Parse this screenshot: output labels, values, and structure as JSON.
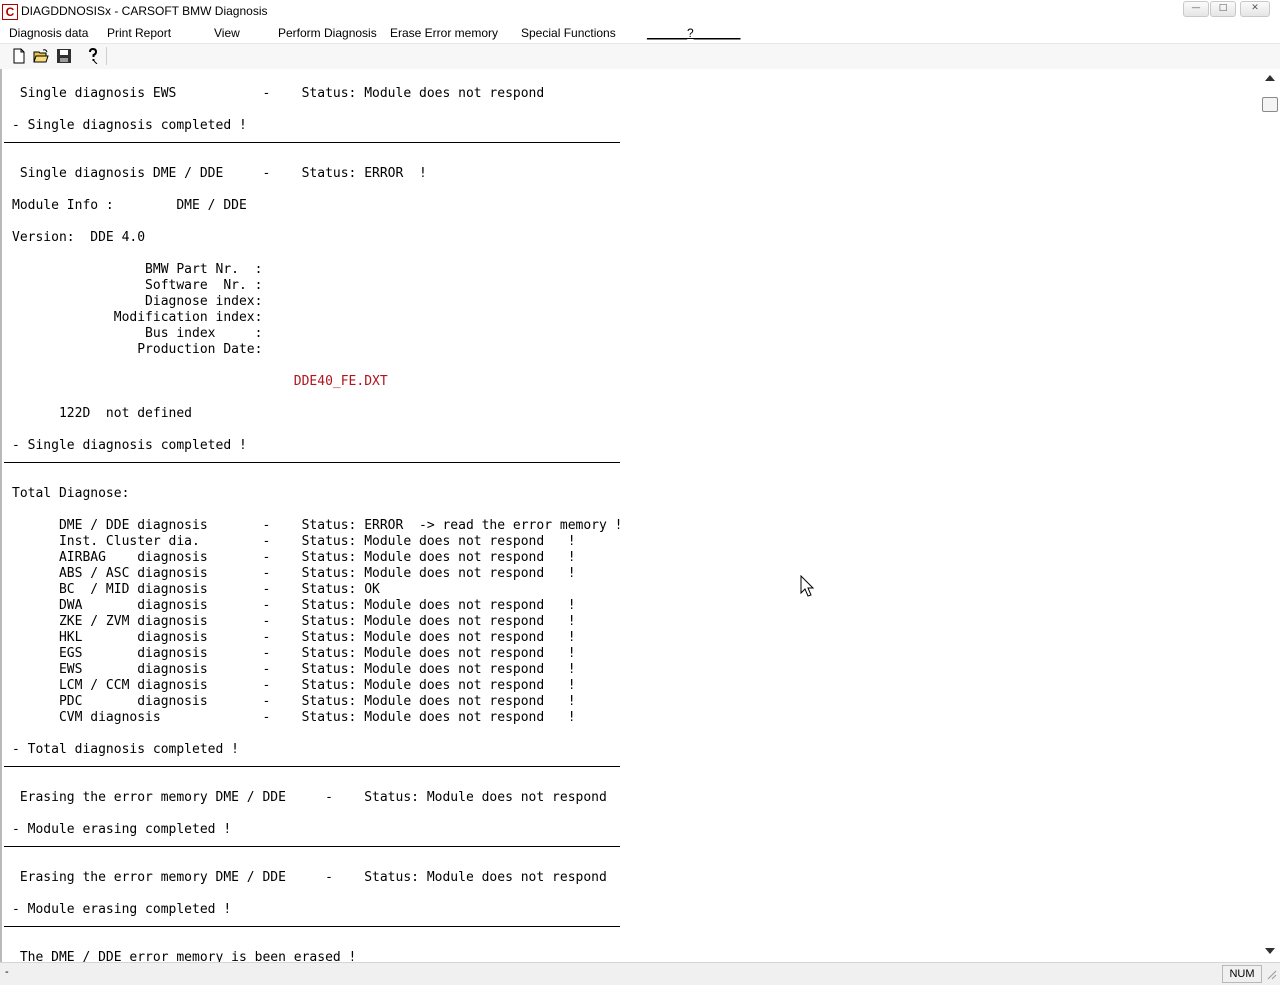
{
  "window": {
    "icon_letter": "C",
    "title": "DIAGDDNOSISx - CARSOFT BMW Diagnosis",
    "minimize_symbol": "—",
    "maximize_symbol": "□",
    "close_symbol": "✕"
  },
  "menu": {
    "items": [
      "Diagnosis data",
      "Print Report",
      "View",
      "Perform Diagnosis",
      "Erase Error memory",
      "Special Functions",
      "______?_______"
    ]
  },
  "toolbar": {
    "icons": [
      "new-file-icon",
      "open-folder-icon",
      "save-disk-icon",
      "help-icon"
    ]
  },
  "report": {
    "lines": [
      {
        "t": "text",
        "v": " Single diagnosis EWS           -    Status: Module does not respond"
      },
      {
        "t": "text",
        "v": ""
      },
      {
        "t": "text",
        "v": "- Single diagnosis completed !"
      },
      {
        "t": "rule",
        "v": ""
      },
      {
        "t": "text",
        "v": ""
      },
      {
        "t": "text",
        "v": " Single diagnosis DME / DDE     -    Status: ERROR  !"
      },
      {
        "t": "text",
        "v": ""
      },
      {
        "t": "text",
        "v": "Module Info :        DME / DDE"
      },
      {
        "t": "text",
        "v": ""
      },
      {
        "t": "text",
        "v": "Version:  DDE 4.0"
      },
      {
        "t": "text",
        "v": ""
      },
      {
        "t": "text",
        "v": "                 BMW Part Nr.  :"
      },
      {
        "t": "text",
        "v": "                 Software  Nr. :"
      },
      {
        "t": "text",
        "v": "                 Diagnose index:"
      },
      {
        "t": "text",
        "v": "             Modification index:"
      },
      {
        "t": "text",
        "v": "                 Bus index     :"
      },
      {
        "t": "text",
        "v": "                Production Date:"
      },
      {
        "t": "text",
        "v": ""
      },
      {
        "t": "red",
        "v": "                                    DDE40_FE.DXT"
      },
      {
        "t": "text",
        "v": ""
      },
      {
        "t": "text",
        "v": "      122D  not defined"
      },
      {
        "t": "text",
        "v": ""
      },
      {
        "t": "text",
        "v": "- Single diagnosis completed !"
      },
      {
        "t": "rule",
        "v": ""
      },
      {
        "t": "text",
        "v": ""
      },
      {
        "t": "text",
        "v": "Total Diagnose:"
      },
      {
        "t": "text",
        "v": ""
      },
      {
        "t": "text",
        "v": "      DME / DDE diagnosis       -    Status: ERROR  -> read the error memory !"
      },
      {
        "t": "text",
        "v": "      Inst. Cluster dia.        -    Status: Module does not respond   !"
      },
      {
        "t": "text",
        "v": "      AIRBAG    diagnosis       -    Status: Module does not respond   !"
      },
      {
        "t": "text",
        "v": "      ABS / ASC diagnosis       -    Status: Module does not respond   !"
      },
      {
        "t": "text",
        "v": "      BC  / MID diagnosis       -    Status: OK"
      },
      {
        "t": "text",
        "v": "      DWA       diagnosis       -    Status: Module does not respond   !"
      },
      {
        "t": "text",
        "v": "      ZKE / ZVM diagnosis       -    Status: Module does not respond   !"
      },
      {
        "t": "text",
        "v": "      HKL       diagnosis       -    Status: Module does not respond   !"
      },
      {
        "t": "text",
        "v": "      EGS       diagnosis       -    Status: Module does not respond   !"
      },
      {
        "t": "text",
        "v": "      EWS       diagnosis       -    Status: Module does not respond   !"
      },
      {
        "t": "text",
        "v": "      LCM / CCM diagnosis       -    Status: Module does not respond   !"
      },
      {
        "t": "text",
        "v": "      PDC       diagnosis       -    Status: Module does not respond   !"
      },
      {
        "t": "text",
        "v": "      CVM diagnosis             -    Status: Module does not respond   !"
      },
      {
        "t": "text",
        "v": ""
      },
      {
        "t": "text",
        "v": "- Total diagnosis completed !"
      },
      {
        "t": "rule",
        "v": ""
      },
      {
        "t": "text",
        "v": ""
      },
      {
        "t": "text",
        "v": " Erasing the error memory DME / DDE     -    Status: Module does not respond"
      },
      {
        "t": "text",
        "v": ""
      },
      {
        "t": "text",
        "v": "- Module erasing completed !"
      },
      {
        "t": "rule",
        "v": ""
      },
      {
        "t": "text",
        "v": ""
      },
      {
        "t": "text",
        "v": " Erasing the error memory DME / DDE     -    Status: Module does not respond"
      },
      {
        "t": "text",
        "v": ""
      },
      {
        "t": "text",
        "v": "- Module erasing completed !"
      },
      {
        "t": "rule",
        "v": ""
      },
      {
        "t": "text",
        "v": ""
      },
      {
        "t": "text",
        "v": " The DME / DDE error memory is been erased !"
      }
    ]
  },
  "statusbar": {
    "text": "-",
    "num_indicator": "NUM"
  },
  "colors": {
    "accent_red": "#b0141e",
    "text": "#000000",
    "background": "#ffffff"
  }
}
